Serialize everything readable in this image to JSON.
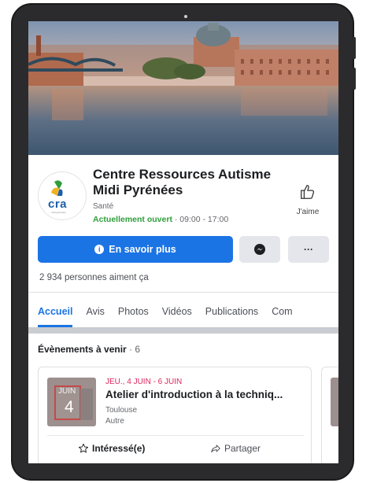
{
  "page": {
    "name": "Centre Ressources Autisme Midi Pyrénées",
    "category": "Santé",
    "status": "Actuellement ouvert",
    "hours": " · 09:00 - 17:00",
    "like_label": "J'aime",
    "logo_text": "cra",
    "logo_subtext": "midi pyrénées"
  },
  "actions": {
    "primary_label": "En savoir plus",
    "messenger_icon": "messenger-icon",
    "more_label": "···"
  },
  "likes_text": "2 934 personnes aiment ça",
  "tabs": [
    {
      "label": "Accueil",
      "active": true
    },
    {
      "label": "Avis"
    },
    {
      "label": "Photos"
    },
    {
      "label": "Vidéos"
    },
    {
      "label": "Publications"
    },
    {
      "label": "Com"
    }
  ],
  "events": {
    "title": "Évènements à venir",
    "count": " · 6",
    "items": [
      {
        "date": "JEU., 4 JUIN - 6 JUIN",
        "title": "Atelier d'introduction à la techniq...",
        "location": "Toulouse",
        "type": "Autre",
        "thumb_month": "JUIN",
        "thumb_day": "4",
        "interested_label": "Intéressé(e)",
        "share_label": "Partager"
      }
    ]
  },
  "colors": {
    "accent": "#1b74e4",
    "open": "#2e9e3b",
    "event_date": "#e0245e"
  }
}
